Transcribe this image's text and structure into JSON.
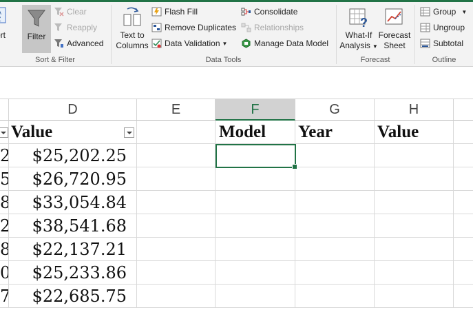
{
  "ribbon": {
    "sort_filter": {
      "sort_label": "ort",
      "filter_label": "Filter",
      "clear_label": "Clear",
      "reapply_label": "Reapply",
      "advanced_label": "Advanced",
      "group_label": "Sort & Filter"
    },
    "data_tools": {
      "text_to_columns_line1": "Text to",
      "text_to_columns_line2": "Columns",
      "flash_fill_label": "Flash Fill",
      "remove_duplicates_label": "Remove Duplicates",
      "data_validation_label": "Data Validation",
      "consolidate_label": "Consolidate",
      "relationships_label": "Relationships",
      "manage_data_model_label": "Manage Data Model",
      "group_label": "Data Tools"
    },
    "forecast": {
      "what_if_line1": "What-If",
      "what_if_line2": "Analysis",
      "forecast_sheet_line1": "Forecast",
      "forecast_sheet_line2": "Sheet",
      "group_label": "Forecast"
    },
    "outline": {
      "group_label_btn": "Group",
      "ungroup_label": "Ungroup",
      "subtotal_label": "Subtotal",
      "group_label": "Outline"
    }
  },
  "sheet": {
    "columns": [
      "D",
      "E",
      "F",
      "G",
      "H"
    ],
    "selected_column": "F",
    "left_partial_cells": [
      "2",
      "5",
      "8",
      "2",
      "8",
      "0",
      "7"
    ],
    "header_row": {
      "D": "Value",
      "F": "Model",
      "G": "Year",
      "H": "Value"
    },
    "values": [
      "$25,202.25",
      "$26,720.95",
      "$33,054.84",
      "$38,541.68",
      "$22,137.21",
      "$25,233.86",
      "$22,685.75"
    ]
  },
  "colors": {
    "accent": "#217346",
    "ribbon_bg": "#f3f3f3",
    "selected_header": "#d2d2d2"
  }
}
